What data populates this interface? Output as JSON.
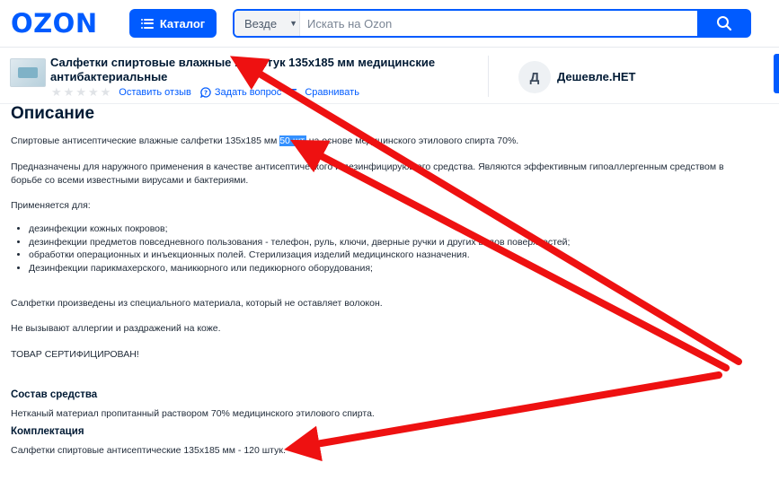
{
  "header": {
    "logo": "OZON",
    "catalog_label": "Каталог",
    "search_scope": "Везде",
    "search_placeholder": "Искать на Ozon"
  },
  "product": {
    "title": "Салфетки спиртовые влажные 120 штук 135х185 мм медицинские антибактериальные",
    "review_link": "Оставить отзыв",
    "question_link": "Задать вопрос",
    "compare_link": "Сравнивать",
    "rating_stars": 0
  },
  "seller": {
    "avatar_letter": "Д",
    "name": "Дешевле.НЕТ"
  },
  "description": {
    "heading": "Описание",
    "line1_before": "Спиртовые антисептические влажные салфетки 135х185 мм ",
    "line1_highlight": "50 шт.",
    "line1_after": " на основе медицинского этилового спирта 70%.",
    "para2_line1": "Предназначены для наружного применения в качестве антисептического и дезинфицирующего средства. Являются эффективным гипоаллергенным средством в",
    "para2_line2": "борьбе со всеми известными вирусами и бактериями.",
    "uses_intro": "Применяется для:",
    "uses": [
      "дезинфекции кожных покровов;",
      "дезинфекции предметов повседневного пользования - телефон, руль, ключи, дверные ручки и других видов поверхностей;",
      "обработки операционных и инъекционных полей. Стерилизация изделий медицинского назначения.",
      "Дезинфекции парикмахерского, маникюрного или педикюрного оборудования;"
    ],
    "material": "Салфетки произведены из специального материала, который не оставляет волокон.",
    "allergy": "Не вызывают аллергии и раздражений на коже.",
    "certified": "ТОВАР СЕРТИФИЦИРОВАН!"
  },
  "composition": {
    "heading": "Состав средства",
    "text": "Нетканый материал пропитанный раствором 70% медицинского этилового спирта."
  },
  "package": {
    "heading": "Комплектация",
    "text": "Салфетки спиртовые антисептические 135х185 мм - 120 штук."
  },
  "colors": {
    "brand": "#005bff",
    "arrow": "#ee1111",
    "highlight": "#3390ff"
  }
}
